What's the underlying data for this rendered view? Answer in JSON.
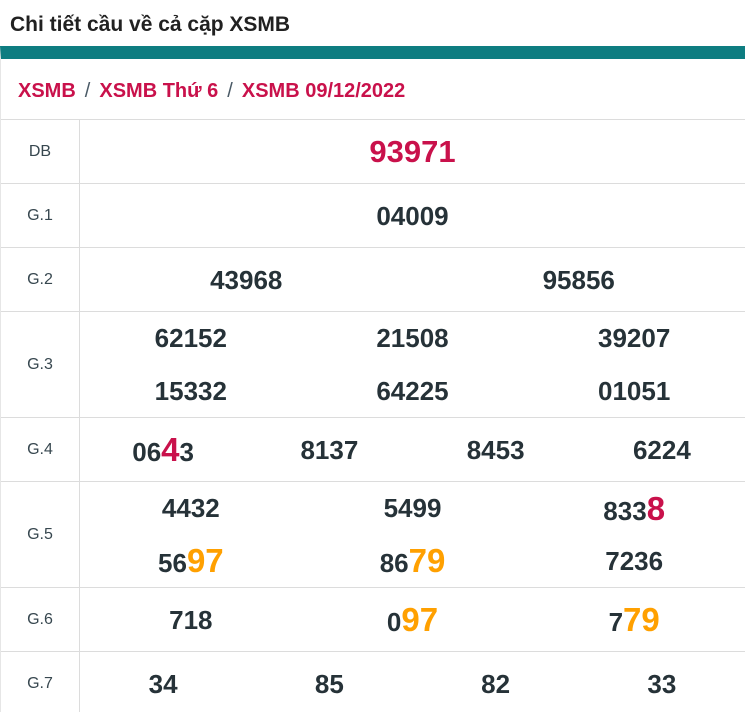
{
  "page_title": "Chi tiết cầu về cả cặp XSMB",
  "breadcrumb": {
    "separator": "/",
    "items": [
      "XSMB",
      "XSMB Thứ 6",
      "XSMB 09/12/2022"
    ]
  },
  "colors": {
    "accent_teal": "#0e7d81",
    "crimson": "#c9114b",
    "orange": "#ffa000",
    "number_dark": "#263238",
    "label_gray": "#37474f",
    "border_gray": "#dcdcdc"
  },
  "prize_table": {
    "rows": [
      {
        "label": "DB",
        "big": true,
        "lines": [
          [
            [
              {
                "t": "93971",
                "c": "red"
              }
            ]
          ]
        ]
      },
      {
        "label": "G.1",
        "lines": [
          [
            [
              {
                "t": "04009"
              }
            ]
          ]
        ]
      },
      {
        "label": "G.2",
        "lines": [
          [
            [
              {
                "t": "43968"
              }
            ],
            [
              {
                "t": "95856"
              }
            ]
          ]
        ]
      },
      {
        "label": "G.3",
        "lines": [
          [
            [
              {
                "t": "62152"
              }
            ],
            [
              {
                "t": "21508"
              }
            ],
            [
              {
                "t": "39207"
              }
            ]
          ],
          [
            [
              {
                "t": "15332"
              }
            ],
            [
              {
                "t": "64225"
              }
            ],
            [
              {
                "t": "01051"
              }
            ]
          ]
        ]
      },
      {
        "label": "G.4",
        "lines": [
          [
            [
              {
                "t": "06"
              },
              {
                "t": "4",
                "c": "red",
                "hl": true
              },
              {
                "t": "3"
              }
            ],
            [
              {
                "t": "8137"
              }
            ],
            [
              {
                "t": "8453"
              }
            ],
            [
              {
                "t": "6224"
              }
            ]
          ]
        ]
      },
      {
        "label": "G.5",
        "lines": [
          [
            [
              {
                "t": "4432"
              }
            ],
            [
              {
                "t": "5499"
              }
            ],
            [
              {
                "t": "833"
              },
              {
                "t": "8",
                "c": "red",
                "hl": true
              }
            ]
          ],
          [
            [
              {
                "t": "56"
              },
              {
                "t": "97",
                "c": "orange",
                "hl": true
              }
            ],
            [
              {
                "t": "86"
              },
              {
                "t": "79",
                "c": "orange",
                "hl": true
              }
            ],
            [
              {
                "t": "7236"
              }
            ]
          ]
        ]
      },
      {
        "label": "G.6",
        "lines": [
          [
            [
              {
                "t": "718"
              }
            ],
            [
              {
                "t": "0"
              },
              {
                "t": "97",
                "c": "orange",
                "hl": true
              }
            ],
            [
              {
                "t": "7"
              },
              {
                "t": "79",
                "c": "orange",
                "hl": true
              }
            ]
          ]
        ]
      },
      {
        "label": "G.7",
        "lines": [
          [
            [
              {
                "t": "34"
              }
            ],
            [
              {
                "t": "85"
              }
            ],
            [
              {
                "t": "82"
              }
            ],
            [
              {
                "t": "33"
              }
            ]
          ]
        ]
      }
    ]
  }
}
